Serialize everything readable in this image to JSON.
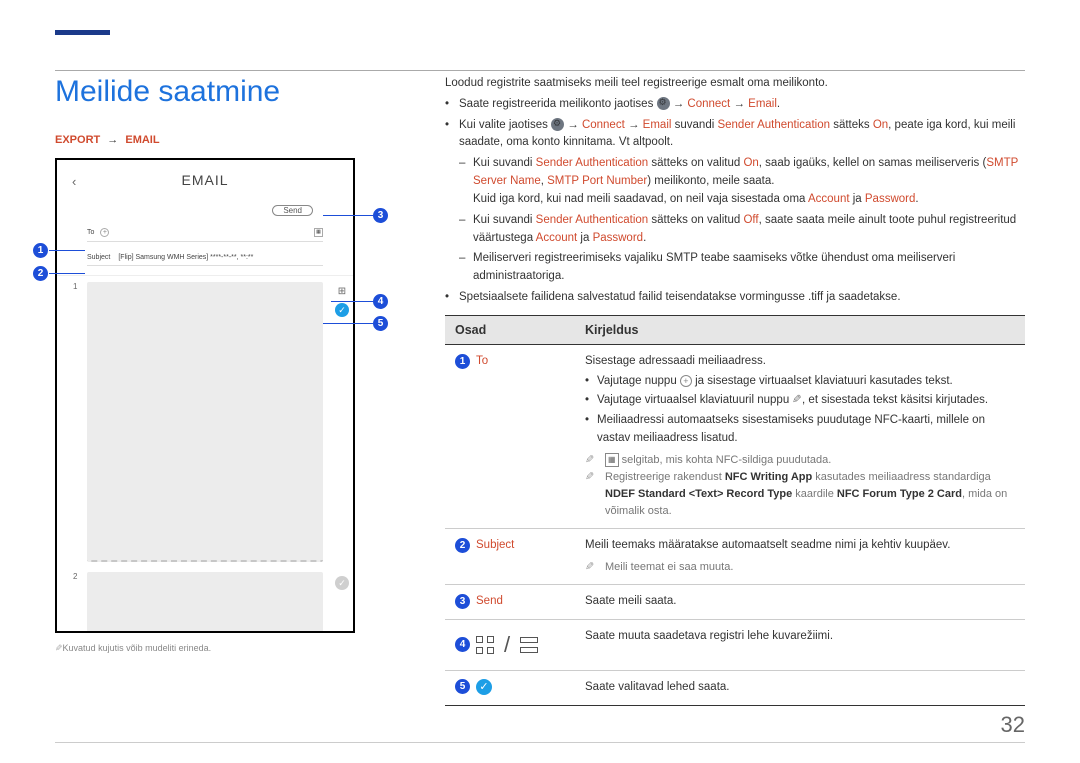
{
  "page_number": "32",
  "title": "Meilide saatmine",
  "breadcrumb": {
    "export": "EXPORT",
    "email": "EMAIL"
  },
  "screenshot": {
    "header": "EMAIL",
    "send_btn": "Send",
    "to_label": "To",
    "subject_label": "Subject",
    "subject_value": "[Flip] Samsung WMH Series] ****-**-**, **:**",
    "thumb1_num": "1",
    "thumb2_num": "2"
  },
  "callouts": [
    "1",
    "2",
    "3",
    "4",
    "5"
  ],
  "intro": "Loodud registrite saatmiseks meili teel registreerige esmalt oma meilikonto.",
  "b1_pre": "Saate registreerida meilikonto jaotises ",
  "b1_connect": "Connect",
  "b1_email": "Email",
  "b2_pre": "Kui valite jaotises ",
  "b2_connect": "Connect",
  "b2_email": "Email",
  "b2_mid1": " suvandi ",
  "b2_sa": "Sender Authentication",
  "b2_mid2": " sätteks ",
  "b2_on": "On",
  "b2_rest": ", peate iga kord, kui meili saadate, oma konto kinnitama. Vt altpoolt.",
  "s1_pre": "Kui suvandi ",
  "s1_sa": "Sender Authentication",
  "s1_mid1": " sätteks on valitud ",
  "s1_on": "On",
  "s1_mid2": ", saab igaüks, kellel on samas meiliserveris (",
  "s1_smtp": "SMTP Server Name",
  "s1_comma": ", ",
  "s1_port": "SMTP Port Number",
  "s1_rest1": ") meilikonto, meile saata.",
  "s1_line2_pre": "Kuid iga kord, kui nad meili saadavad, on neil vaja sisestada oma ",
  "s1_acc": "Account",
  "s1_ja": " ja ",
  "s1_pass": "Password",
  "s2_pre": "Kui suvandi ",
  "s2_sa": "Sender Authentication",
  "s2_mid1": " sätteks on valitud ",
  "s2_off": "Off",
  "s2_rest_pre": ", saate saata meile ainult toote puhul registreeritud väärtustega ",
  "s2_acc": "Account",
  "s2_ja": " ja ",
  "s2_pass": "Password",
  "s3": "Meiliserveri registreerimiseks vajaliku SMTP teabe saamiseks võtke ühendust oma meiliserveri administraatoriga.",
  "b3": "Spetsiaalsete failidena salvestatud failid teisendatakse vormingusse .tiff ja saadetakse.",
  "table": {
    "h1": "Osad",
    "h2": "Kirjeldus",
    "r1": {
      "label": "To",
      "p1": "Sisestage adressaadi meiliaadress.",
      "li1_pre": "Vajutage nuppu ",
      "li1_post": " ja sisestage virtuaalset klaviatuuri kasutades tekst.",
      "li2_pre": "Vajutage virtuaalsel klaviatuuril nuppu ",
      "li2_post": ", et sisestada tekst käsitsi kirjutades.",
      "li3": "Meiliaadressi automaatseks sisestamiseks puudutage NFC-kaarti, millele on vastav meiliaadress lisatud.",
      "n1_post": " selgitab, mis kohta NFC-sildiga puudutada.",
      "n2_pre": "Registreerige rakendust ",
      "n2_app": "NFC Writing App",
      "n2_mid1": " kasutades meiliaadress standardiga ",
      "n2_ndef": "NDEF Standard <Text> Record Type",
      "n2_mid2": " kaardile ",
      "n2_card": "NFC Forum Type 2 Card",
      "n2_post": ", mida on võimalik osta."
    },
    "r2": {
      "label": "Subject",
      "p1": "Meili teemaks määratakse automaatselt seadme nimi ja kehtiv kuupäev.",
      "note": "Meili teemat ei saa muuta."
    },
    "r3": {
      "label": "Send",
      "p1": "Saate meili saata."
    },
    "r4": {
      "p1": "Saate muuta saadetava registri lehe kuvarežiimi."
    },
    "r5": {
      "p1": "Saate valitavad lehed saata."
    }
  },
  "footnote": "Kuvatud kujutis võib mudeliti erineda."
}
